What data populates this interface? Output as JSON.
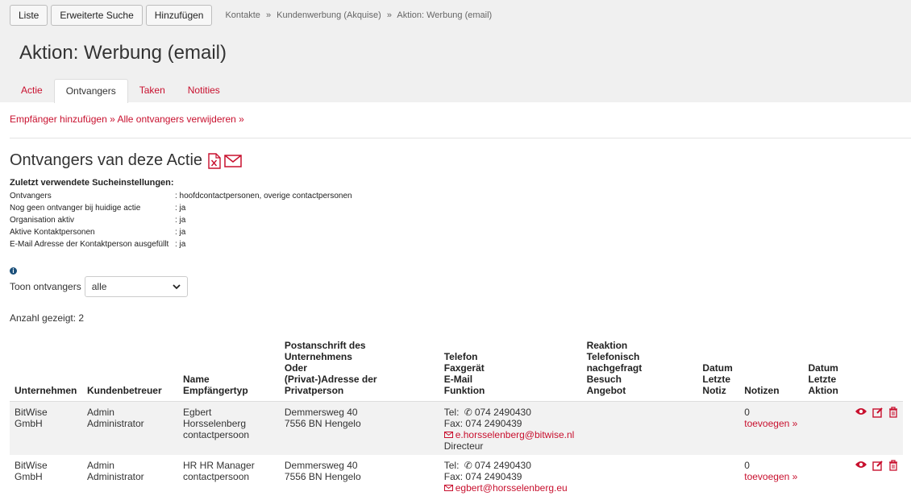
{
  "toolbar": {
    "liste": "Liste",
    "erweiterte_suche": "Erweiterte Suche",
    "hinzufuegen": "Hinzufügen"
  },
  "breadcrumb": {
    "items": [
      "Kontakte",
      "Kundenwerbung (Akquise)",
      "Aktion: Werbung (email)"
    ],
    "sep": "»"
  },
  "page_title": "Aktion: Werbung (email)",
  "tabs": [
    "Actie",
    "Ontvangers",
    "Taken",
    "Notities"
  ],
  "actions": {
    "add": "Empfänger hinzufügen »",
    "remove": "Alle ontvangers verwijderen »"
  },
  "section_title": "Ontvangers van deze Actie",
  "search": {
    "heading": "Zuletzt verwendete Sucheinstellungen:",
    "rows": [
      {
        "k": "Ontvangers",
        "v": ": hoofdcontactpersonen, overige contactpersonen"
      },
      {
        "k": "Nog geen ontvanger bij huidige actie",
        "v": ": ja"
      },
      {
        "k": "Organisation aktiv",
        "v": ": ja"
      },
      {
        "k": "Aktive Kontaktpersonen",
        "v": ": ja"
      },
      {
        "k": "E-Mail Adresse der Kontaktperson ausgefüllt",
        "v": ": ja"
      }
    ]
  },
  "filter": {
    "label": "Toon ontvangers",
    "value": "alle"
  },
  "count": "Anzahl gezeigt: 2",
  "columns": {
    "unternehmen": "Unternehmen",
    "kundenbetreuer": "Kundenbetreuer",
    "name": [
      "Name",
      "Empfängertyp"
    ],
    "adresse": [
      "Postanschrift des Unternehmens",
      "Oder",
      "(Privat-)Adresse der Privatperson"
    ],
    "kontakt": [
      "Telefon",
      "Faxgerät",
      "E-Mail",
      "Funktion"
    ],
    "reaktion": [
      "Reaktion",
      "Telefonisch nachgefragt",
      "Besuch",
      "Angebot"
    ],
    "datum_notiz": [
      "Datum",
      "Letzte",
      "Notiz"
    ],
    "notizen": "Notizen",
    "datum_aktion": [
      "Datum",
      "Letzte",
      "Aktion"
    ]
  },
  "rows": [
    {
      "unternehmen": "BitWise GmbH",
      "kundenbetreuer": "Admin Administrator",
      "name": "Egbert Horsselenberg",
      "typ": "contactpersoon",
      "adresse1": "Demmersweg 40",
      "adresse2": "7556 BN Hengelo",
      "tel": "Tel: ",
      "tel_num": "074 2490430",
      "fax": "Fax: 074 2490439",
      "email": "e.horsselenberg@bitwise.nl",
      "funktion": "Directeur",
      "notizen": "0",
      "toevoegen": "toevoegen »"
    },
    {
      "unternehmen": "BitWise GmbH",
      "kundenbetreuer": "Admin Administrator",
      "name": "HR HR Manager",
      "typ": "contactpersoon",
      "adresse1": "Demmersweg 40",
      "adresse2": "7556 BN Hengelo",
      "tel": "Tel: ",
      "tel_num": "074 2490430",
      "fax": "Fax: 074 2490439",
      "email": "egbert@horsselenberg.eu",
      "funktion": "",
      "notizen": "0",
      "toevoegen": "toevoegen »"
    }
  ],
  "colors": {
    "accent": "#c8102e",
    "header_bg": "#f0f0f0",
    "row_bg": "#f2f2f2"
  }
}
